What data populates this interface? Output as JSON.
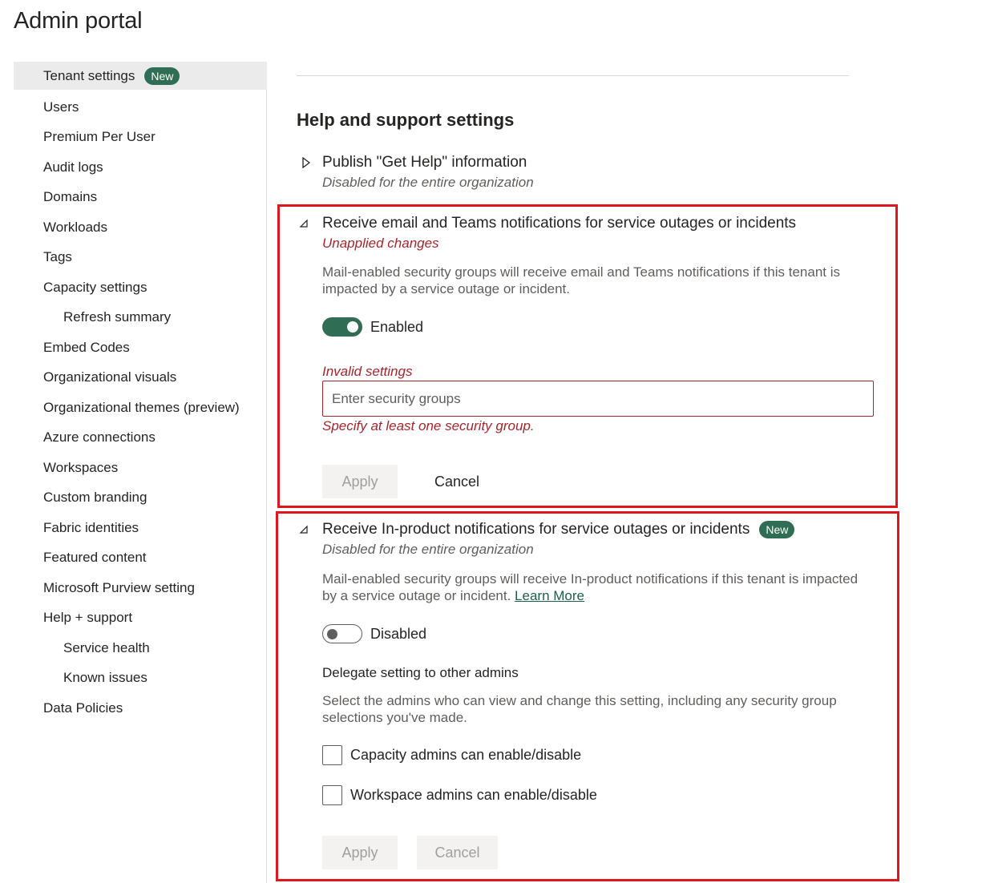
{
  "page_title": "Admin portal",
  "sidebar": {
    "items": [
      {
        "label": "Tenant settings",
        "badge": "New"
      },
      {
        "label": "Users"
      },
      {
        "label": "Premium Per User"
      },
      {
        "label": "Audit logs"
      },
      {
        "label": "Domains"
      },
      {
        "label": "Workloads"
      },
      {
        "label": "Tags"
      },
      {
        "label": "Capacity settings"
      },
      {
        "label": "Refresh summary"
      },
      {
        "label": "Embed Codes"
      },
      {
        "label": "Organizational visuals"
      },
      {
        "label": "Organizational themes (preview)"
      },
      {
        "label": "Azure connections"
      },
      {
        "label": "Workspaces"
      },
      {
        "label": "Custom branding"
      },
      {
        "label": "Fabric identities"
      },
      {
        "label": "Featured content"
      },
      {
        "label": "Microsoft Purview setting"
      },
      {
        "label": "Help + support"
      },
      {
        "label": "Service health"
      },
      {
        "label": "Known issues"
      },
      {
        "label": "Data Policies"
      }
    ]
  },
  "main": {
    "section_title": "Help and support settings",
    "settings": [
      {
        "title": "Publish \"Get Help\" information",
        "status": "Disabled for the entire organization"
      },
      {
        "title": "Receive email and Teams notifications for service outages or incidents",
        "status": "Unapplied changes",
        "description": "Mail-enabled security groups will receive email and Teams notifications if this tenant is impacted by a service outage or incident.",
        "toggle_label": "Enabled",
        "field_label": "Invalid settings",
        "input_placeholder": "Enter security groups",
        "field_error": "Specify at least one security group.",
        "apply_label": "Apply",
        "cancel_label": "Cancel"
      },
      {
        "title": "Receive In-product notifications for service outages or incidents",
        "badge": "New",
        "status": "Disabled for the entire organization",
        "description": "Mail-enabled security groups will receive In-product notifications if this tenant is impacted by a service outage or incident.",
        "link": "Learn More",
        "toggle_label": "Disabled",
        "delegate_title": "Delegate setting to other admins",
        "delegate_description": "Select the admins who can view and change this setting, including any security group selections you've made.",
        "checkbox_capacity": "Capacity admins can enable/disable",
        "checkbox_workspace": "Workspace admins can enable/disable",
        "apply_label": "Apply",
        "cancel_label": "Cancel"
      }
    ]
  },
  "colors": {
    "accent": "#2f6e54",
    "error": "#a4262c",
    "highlight": "#e0161f"
  }
}
